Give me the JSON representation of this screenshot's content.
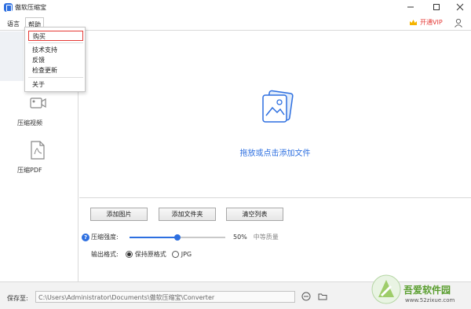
{
  "window": {
    "title": "傲软压缩宝",
    "controls": [
      "minimize",
      "maximize",
      "close"
    ]
  },
  "menubar": {
    "language": "语言",
    "help": "帮助",
    "vip": "开通VIP"
  },
  "help_menu": {
    "items": [
      "购买",
      "技术支持",
      "反馈",
      "检查更新",
      "关于"
    ]
  },
  "sidebar": {
    "items": [
      {
        "label": "压缩视频",
        "icon": "video-icon"
      },
      {
        "label": "压缩PDF",
        "icon": "pdf-icon"
      }
    ]
  },
  "main": {
    "drop_text": "拖放或点击添加文件"
  },
  "toolbar": {
    "add_image": "添加图片",
    "add_folder": "添加文件夹",
    "clear_list": "清空列表"
  },
  "options": {
    "strength_label": "压缩强度:",
    "strength_value": "50%",
    "strength_percent": 50,
    "quality_label": "中等质量",
    "format_label": "输出格式:",
    "format_options": [
      "保持原格式",
      "JPG"
    ],
    "format_selected": "保持原格式"
  },
  "bottom": {
    "save_label": "保存至:",
    "save_path": "C:\\Users\\Administrator\\Documents\\傲软压缩宝\\Converter"
  },
  "watermark": {
    "brand": "吾爱软件园",
    "url": "www.52zixue.com"
  },
  "colors": {
    "accent": "#2d6fe0",
    "highlight_border": "#e53935",
    "vip": "#e53935"
  }
}
